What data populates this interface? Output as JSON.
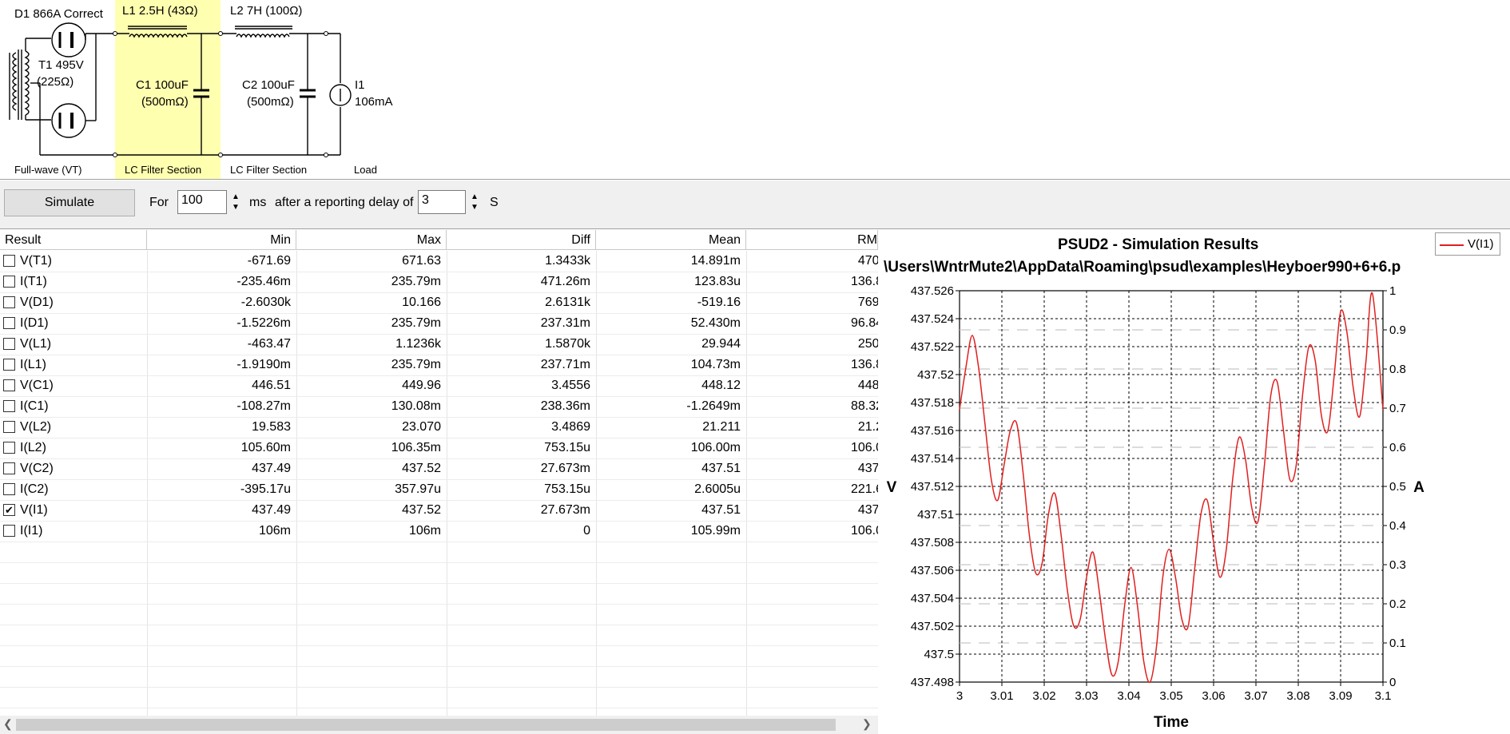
{
  "circuit": {
    "d1_label": "D1 866A Correct",
    "l1_label": "L1 2.5H (43Ω)",
    "l2_label": "L2 7H (100Ω)",
    "t1_label": "T1 495V",
    "t1_res": "(225Ω)",
    "c1_label": "C1 100uF",
    "c1_esr": "(500mΩ)",
    "c2_label": "C2 100uF",
    "c2_esr": "(500mΩ)",
    "i1_label": "I1",
    "i1_value": "106mA",
    "sections": [
      "Full-wave (VT)",
      "LC Filter Section",
      "LC Filter Section",
      "Load"
    ],
    "highlight_color": "#ffffb0"
  },
  "toolbar": {
    "simulate_label": "Simulate",
    "for_label": "For",
    "duration_value": "100",
    "ms_label": "ms",
    "delay_label": "after a reporting delay of",
    "delay_value": "3",
    "s_label": "S"
  },
  "results": {
    "columns": [
      "Result",
      "Min",
      "Max",
      "Diff",
      "Mean",
      "RM"
    ],
    "rows": [
      {
        "name": "V(T1)",
        "min": "-671.69",
        "max": "671.63",
        "diff": "1.3433k",
        "mean": "14.891m",
        "rms": "470.",
        "checked": false
      },
      {
        "name": "I(T1)",
        "min": "-235.46m",
        "max": "235.79m",
        "diff": "471.26m",
        "mean": "123.83u",
        "rms": "136.8",
        "checked": false
      },
      {
        "name": "V(D1)",
        "min": "-2.6030k",
        "max": "10.166",
        "diff": "2.6131k",
        "mean": "-519.16",
        "rms": "769.",
        "checked": false
      },
      {
        "name": "I(D1)",
        "min": "-1.5226m",
        "max": "235.79m",
        "diff": "237.31m",
        "mean": "52.430m",
        "rms": "96.84",
        "checked": false
      },
      {
        "name": "V(L1)",
        "min": "-463.47",
        "max": "1.1236k",
        "diff": "1.5870k",
        "mean": "29.944",
        "rms": "250.",
        "checked": false
      },
      {
        "name": "I(L1)",
        "min": "-1.9190m",
        "max": "235.79m",
        "diff": "237.71m",
        "mean": "104.73m",
        "rms": "136.8",
        "checked": false
      },
      {
        "name": "V(C1)",
        "min": "446.51",
        "max": "449.96",
        "diff": "3.4556",
        "mean": "448.12",
        "rms": "448.",
        "checked": false
      },
      {
        "name": "I(C1)",
        "min": "-108.27m",
        "max": "130.08m",
        "diff": "238.36m",
        "mean": "-1.2649m",
        "rms": "88.32",
        "checked": false
      },
      {
        "name": "V(L2)",
        "min": "19.583",
        "max": "23.070",
        "diff": "3.4869",
        "mean": "21.211",
        "rms": "21.2",
        "checked": false
      },
      {
        "name": "I(L2)",
        "min": "105.60m",
        "max": "106.35m",
        "diff": "753.15u",
        "mean": "106.00m",
        "rms": "106.0",
        "checked": false
      },
      {
        "name": "V(C2)",
        "min": "437.49",
        "max": "437.52",
        "diff": "27.673m",
        "mean": "437.51",
        "rms": "437.",
        "checked": false
      },
      {
        "name": "I(C2)",
        "min": "-395.17u",
        "max": "357.97u",
        "diff": "753.15u",
        "mean": "2.6005u",
        "rms": "221.6",
        "checked": false
      },
      {
        "name": "V(I1)",
        "min": "437.49",
        "max": "437.52",
        "diff": "27.673m",
        "mean": "437.51",
        "rms": "437.",
        "checked": true
      },
      {
        "name": "I(I1)",
        "min": "106m",
        "max": "106m",
        "diff": "0",
        "mean": "105.99m",
        "rms": "106.0",
        "checked": false
      }
    ]
  },
  "chart_data": {
    "type": "line",
    "title": "PSUD2 - Simulation Results",
    "subtitle": "\\Users\\WntrMute2\\AppData\\Roaming\\psud\\examples\\Heyboer990+6+6.p",
    "xlabel": "Time",
    "ylabel": "V",
    "y2label": "A",
    "xlim": [
      3,
      3.1
    ],
    "ylim": [
      437.498,
      437.526
    ],
    "y2lim": [
      0,
      1
    ],
    "xticks": [
      "3",
      "3.01",
      "3.02",
      "3.03",
      "3.04",
      "3.05",
      "3.06",
      "3.07",
      "3.08",
      "3.09",
      "3.1"
    ],
    "yticks": [
      "437.498",
      "437.5",
      "437.502",
      "437.504",
      "437.506",
      "437.508",
      "437.51",
      "437.512",
      "437.514",
      "437.516",
      "437.518",
      "437.52",
      "437.522",
      "437.524",
      "437.526"
    ],
    "y2ticks": [
      "0",
      "0.1",
      "0.2",
      "0.3",
      "0.4",
      "0.5",
      "0.6",
      "0.7",
      "0.8",
      "0.9",
      "1"
    ],
    "grid": true,
    "legend_position": "top-right",
    "series": [
      {
        "name": "V(I1)",
        "color": "#e02020",
        "x": [
          3.0,
          3.0015,
          3.003,
          3.0045,
          3.006,
          3.0075,
          3.009,
          3.0105,
          3.012,
          3.0135,
          3.015,
          3.0165,
          3.018,
          3.0195,
          3.021,
          3.0225,
          3.024,
          3.0255,
          3.027,
          3.0285,
          3.03,
          3.0315,
          3.033,
          3.0345,
          3.036,
          3.0375,
          3.039,
          3.0405,
          3.042,
          3.0435,
          3.045,
          3.0465,
          3.048,
          3.0495,
          3.051,
          3.0525,
          3.054,
          3.0555,
          3.057,
          3.0585,
          3.06,
          3.0615,
          3.063,
          3.0645,
          3.066,
          3.0675,
          3.069,
          3.0705,
          3.072,
          3.0735,
          3.075,
          3.0765,
          3.078,
          3.0795,
          3.081,
          3.0825,
          3.084,
          3.0855,
          3.087,
          3.0885,
          3.09,
          3.0915,
          3.093,
          3.0945,
          3.096,
          3.0975,
          3.1
        ],
        "y": [
          437.5175,
          437.5205,
          437.5228,
          437.5205,
          437.5165,
          437.5125,
          437.511,
          437.5135,
          437.516,
          437.5165,
          437.513,
          437.5085,
          437.5058,
          437.5065,
          437.51,
          437.5115,
          437.5085,
          437.5045,
          437.502,
          437.5025,
          437.5055,
          437.5073,
          437.5045,
          437.501,
          437.4985,
          437.4995,
          437.5035,
          437.5062,
          437.5035,
          437.4995,
          437.498,
          437.5005,
          437.5055,
          437.5075,
          437.5055,
          437.5025,
          437.502,
          437.506,
          437.51,
          437.511,
          437.508,
          437.5055,
          437.5075,
          437.5125,
          437.5155,
          437.514,
          437.5105,
          437.5095,
          437.5135,
          437.5185,
          437.5195,
          437.516,
          437.5125,
          437.5135,
          437.5185,
          437.522,
          437.521,
          437.517,
          437.516,
          437.52,
          437.5245,
          437.523,
          437.519,
          437.517,
          437.521,
          437.5258,
          437.5175
        ]
      }
    ]
  }
}
